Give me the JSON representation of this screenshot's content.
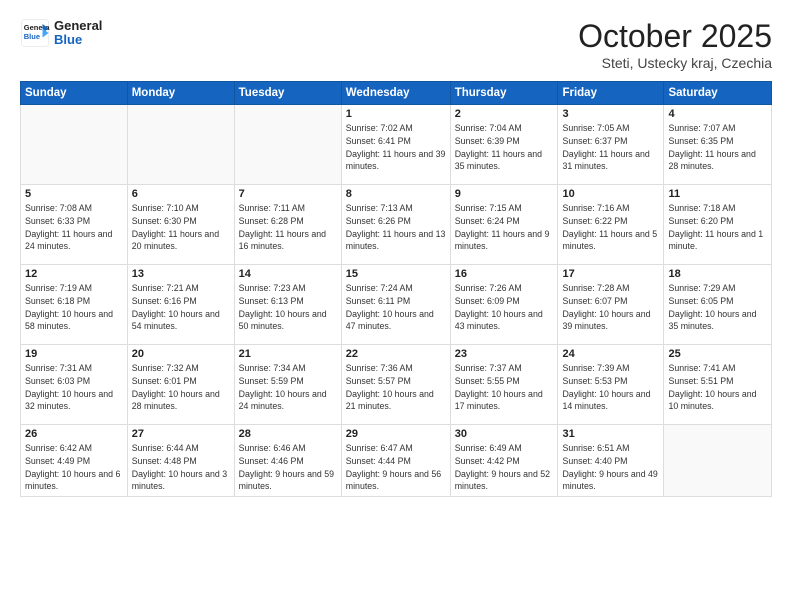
{
  "logo": {
    "line1": "General",
    "line2": "Blue"
  },
  "title": "October 2025",
  "subtitle": "Steti, Ustecky kraj, Czechia",
  "weekdays": [
    "Sunday",
    "Monday",
    "Tuesday",
    "Wednesday",
    "Thursday",
    "Friday",
    "Saturday"
  ],
  "weeks": [
    [
      {
        "day": "",
        "info": ""
      },
      {
        "day": "",
        "info": ""
      },
      {
        "day": "",
        "info": ""
      },
      {
        "day": "1",
        "info": "Sunrise: 7:02 AM\nSunset: 6:41 PM\nDaylight: 11 hours and 39 minutes."
      },
      {
        "day": "2",
        "info": "Sunrise: 7:04 AM\nSunset: 6:39 PM\nDaylight: 11 hours and 35 minutes."
      },
      {
        "day": "3",
        "info": "Sunrise: 7:05 AM\nSunset: 6:37 PM\nDaylight: 11 hours and 31 minutes."
      },
      {
        "day": "4",
        "info": "Sunrise: 7:07 AM\nSunset: 6:35 PM\nDaylight: 11 hours and 28 minutes."
      }
    ],
    [
      {
        "day": "5",
        "info": "Sunrise: 7:08 AM\nSunset: 6:33 PM\nDaylight: 11 hours and 24 minutes."
      },
      {
        "day": "6",
        "info": "Sunrise: 7:10 AM\nSunset: 6:30 PM\nDaylight: 11 hours and 20 minutes."
      },
      {
        "day": "7",
        "info": "Sunrise: 7:11 AM\nSunset: 6:28 PM\nDaylight: 11 hours and 16 minutes."
      },
      {
        "day": "8",
        "info": "Sunrise: 7:13 AM\nSunset: 6:26 PM\nDaylight: 11 hours and 13 minutes."
      },
      {
        "day": "9",
        "info": "Sunrise: 7:15 AM\nSunset: 6:24 PM\nDaylight: 11 hours and 9 minutes."
      },
      {
        "day": "10",
        "info": "Sunrise: 7:16 AM\nSunset: 6:22 PM\nDaylight: 11 hours and 5 minutes."
      },
      {
        "day": "11",
        "info": "Sunrise: 7:18 AM\nSunset: 6:20 PM\nDaylight: 11 hours and 1 minute."
      }
    ],
    [
      {
        "day": "12",
        "info": "Sunrise: 7:19 AM\nSunset: 6:18 PM\nDaylight: 10 hours and 58 minutes."
      },
      {
        "day": "13",
        "info": "Sunrise: 7:21 AM\nSunset: 6:16 PM\nDaylight: 10 hours and 54 minutes."
      },
      {
        "day": "14",
        "info": "Sunrise: 7:23 AM\nSunset: 6:13 PM\nDaylight: 10 hours and 50 minutes."
      },
      {
        "day": "15",
        "info": "Sunrise: 7:24 AM\nSunset: 6:11 PM\nDaylight: 10 hours and 47 minutes."
      },
      {
        "day": "16",
        "info": "Sunrise: 7:26 AM\nSunset: 6:09 PM\nDaylight: 10 hours and 43 minutes."
      },
      {
        "day": "17",
        "info": "Sunrise: 7:28 AM\nSunset: 6:07 PM\nDaylight: 10 hours and 39 minutes."
      },
      {
        "day": "18",
        "info": "Sunrise: 7:29 AM\nSunset: 6:05 PM\nDaylight: 10 hours and 35 minutes."
      }
    ],
    [
      {
        "day": "19",
        "info": "Sunrise: 7:31 AM\nSunset: 6:03 PM\nDaylight: 10 hours and 32 minutes."
      },
      {
        "day": "20",
        "info": "Sunrise: 7:32 AM\nSunset: 6:01 PM\nDaylight: 10 hours and 28 minutes."
      },
      {
        "day": "21",
        "info": "Sunrise: 7:34 AM\nSunset: 5:59 PM\nDaylight: 10 hours and 24 minutes."
      },
      {
        "day": "22",
        "info": "Sunrise: 7:36 AM\nSunset: 5:57 PM\nDaylight: 10 hours and 21 minutes."
      },
      {
        "day": "23",
        "info": "Sunrise: 7:37 AM\nSunset: 5:55 PM\nDaylight: 10 hours and 17 minutes."
      },
      {
        "day": "24",
        "info": "Sunrise: 7:39 AM\nSunset: 5:53 PM\nDaylight: 10 hours and 14 minutes."
      },
      {
        "day": "25",
        "info": "Sunrise: 7:41 AM\nSunset: 5:51 PM\nDaylight: 10 hours and 10 minutes."
      }
    ],
    [
      {
        "day": "26",
        "info": "Sunrise: 6:42 AM\nSunset: 4:49 PM\nDaylight: 10 hours and 6 minutes."
      },
      {
        "day": "27",
        "info": "Sunrise: 6:44 AM\nSunset: 4:48 PM\nDaylight: 10 hours and 3 minutes."
      },
      {
        "day": "28",
        "info": "Sunrise: 6:46 AM\nSunset: 4:46 PM\nDaylight: 9 hours and 59 minutes."
      },
      {
        "day": "29",
        "info": "Sunrise: 6:47 AM\nSunset: 4:44 PM\nDaylight: 9 hours and 56 minutes."
      },
      {
        "day": "30",
        "info": "Sunrise: 6:49 AM\nSunset: 4:42 PM\nDaylight: 9 hours and 52 minutes."
      },
      {
        "day": "31",
        "info": "Sunrise: 6:51 AM\nSunset: 4:40 PM\nDaylight: 9 hours and 49 minutes."
      },
      {
        "day": "",
        "info": ""
      }
    ]
  ]
}
